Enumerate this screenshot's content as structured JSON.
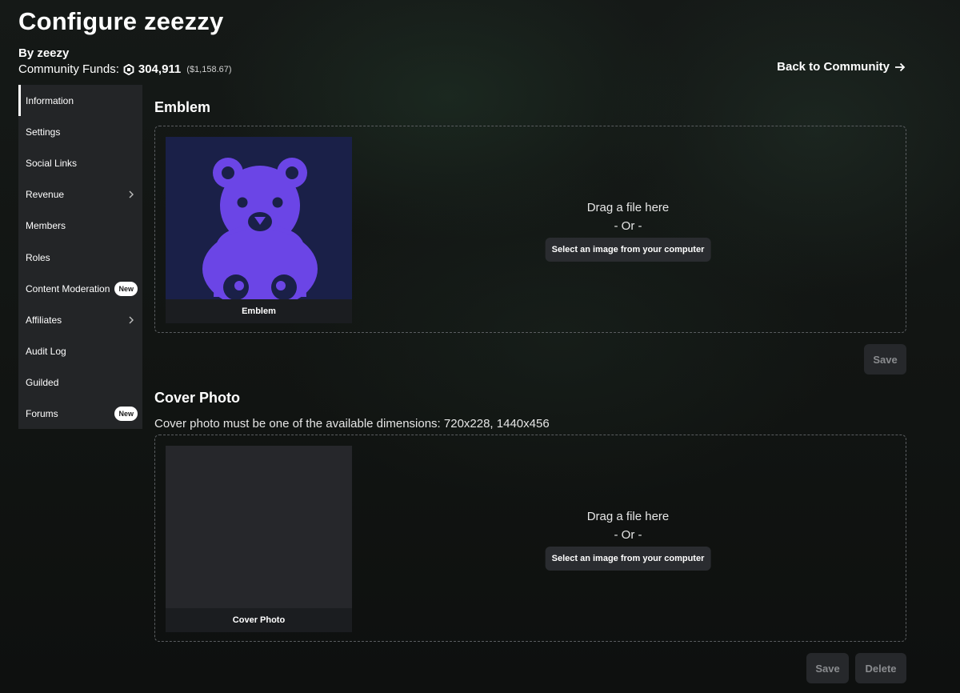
{
  "header": {
    "title": "Configure zeezzy",
    "byline": "By zeezy",
    "funds_label": "Community Funds:",
    "funds_amount": "304,911",
    "funds_usd": "($1,158.67)",
    "back_link": "Back to Community"
  },
  "sidebar": {
    "items": [
      {
        "label": "Information"
      },
      {
        "label": "Settings"
      },
      {
        "label": "Social Links"
      },
      {
        "label": "Revenue"
      },
      {
        "label": "Members"
      },
      {
        "label": "Roles"
      },
      {
        "label": "Content Moderation",
        "badge": "New"
      },
      {
        "label": "Affiliates"
      },
      {
        "label": "Audit Log"
      },
      {
        "label": "Guilded"
      },
      {
        "label": "Forums",
        "badge": "New"
      }
    ]
  },
  "emblem": {
    "title": "Emblem",
    "thumb_caption": "Emblem",
    "drag_text": "Drag a file here",
    "or_text": "- Or -",
    "select_button": "Select an image from your computer",
    "save_button": "Save"
  },
  "cover": {
    "title": "Cover Photo",
    "hint": "Cover photo must be one of the available dimensions: 720x228, 1440x456",
    "thumb_caption": "Cover Photo",
    "drag_text": "Drag a file here",
    "or_text": "- Or -",
    "select_button": "Select an image from your computer",
    "save_button": "Save",
    "delete_button": "Delete"
  },
  "colors": {
    "accent_purple": "#6b45e6",
    "emblem_bg": "#1a2048",
    "sidebar_bg": "#232527"
  },
  "icons": {
    "funds": "robux-icon",
    "back": "arrow-right-icon",
    "submenu": "chevron-right-icon",
    "emblem_image": "teddy-bear-icon"
  }
}
